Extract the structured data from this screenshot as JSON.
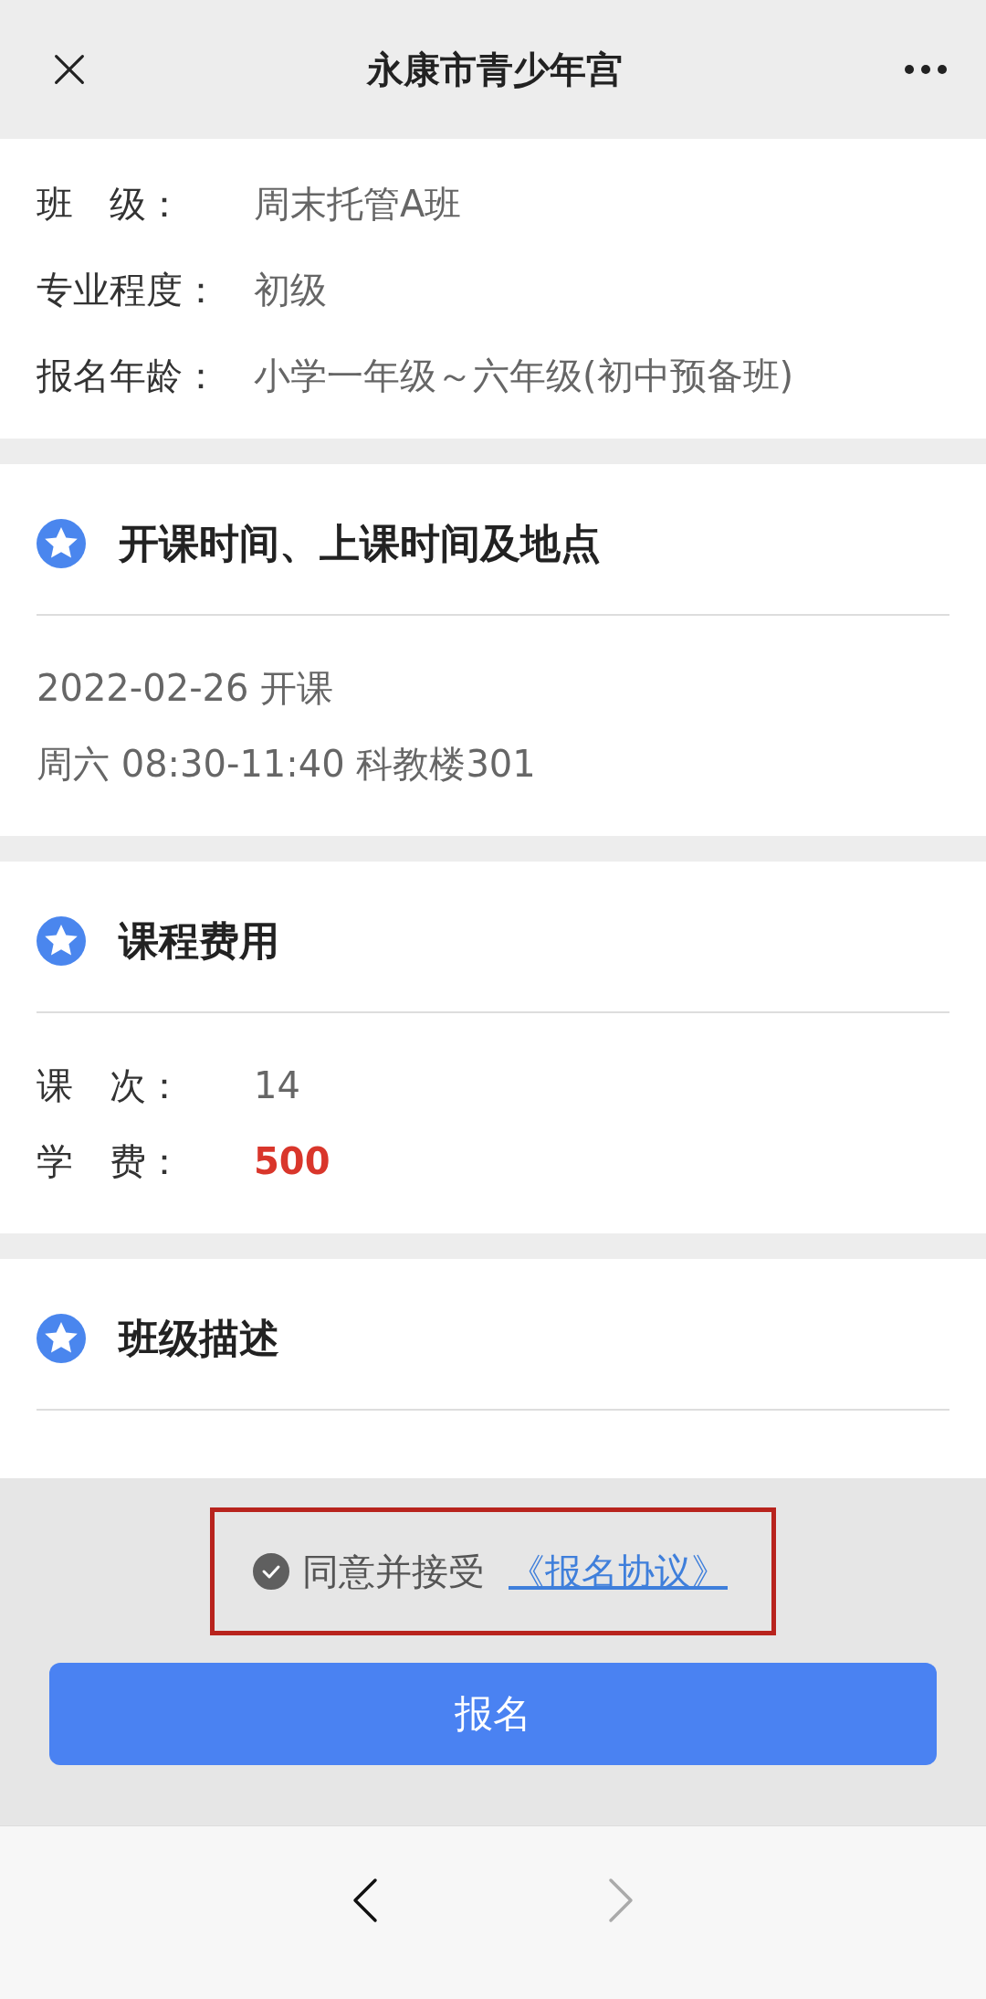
{
  "header": {
    "title": "永康市青少年宫"
  },
  "info": [
    {
      "label": "班　级：",
      "value": "周末托管A班"
    },
    {
      "label": "专业程度：",
      "value": "初级"
    },
    {
      "label": "报名年龄：",
      "value": "小学一年级～六年级(初中预备班)"
    }
  ],
  "sections": [
    {
      "title": "开课时间、上课时间及地点",
      "kind": "lines",
      "lines": [
        "2022-02-26 开课",
        "周六 08:30-11:40 科教楼301"
      ]
    },
    {
      "title": "课程费用",
      "kind": "fields",
      "fields": [
        {
          "label": "课　次：",
          "value": "14",
          "emphasis": false
        },
        {
          "label": "学　费：",
          "value": "500",
          "emphasis": true
        }
      ]
    },
    {
      "title": "班级描述",
      "kind": "empty"
    }
  ],
  "agreement": {
    "checked": true,
    "text": "同意并接受",
    "link": "《报名协议》",
    "highlighted": true
  },
  "submit": {
    "label": "报名"
  },
  "nav": [
    {
      "kind": "back",
      "disabled": false
    },
    {
      "kind": "forward",
      "disabled": true
    }
  ]
}
